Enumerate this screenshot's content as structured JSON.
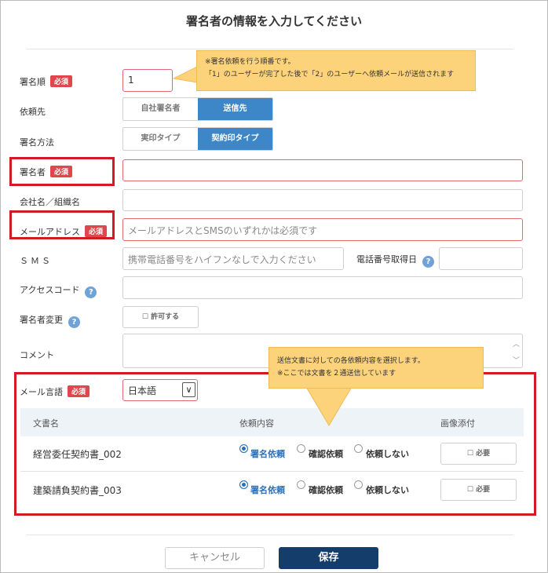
{
  "dialog": {
    "title": "署名者の情報を入力してください"
  },
  "required_badge": "必須",
  "help_glyph": "?",
  "form": {
    "order": {
      "label": "署名順",
      "value": "1"
    },
    "recipient": {
      "label": "依頼先",
      "options": [
        "自社署名者",
        "送信先"
      ],
      "selected": "送信先"
    },
    "method": {
      "label": "署名方法",
      "options": [
        "実印タイプ",
        "契約印タイプ"
      ],
      "selected": "契約印タイプ"
    },
    "signer": {
      "label": "署名者",
      "value": ""
    },
    "company": {
      "label": "会社名／組織名",
      "value": ""
    },
    "email": {
      "label": "メールアドレス",
      "placeholder": "メールアドレスとSMSのいずれかは必須です"
    },
    "sms": {
      "label": "ＳＭＳ",
      "placeholder": "携帯電話番号をハイフンなしで入力ください",
      "date_label": "電話番号取得日"
    },
    "access_code": {
      "label": "アクセスコード"
    },
    "signer_change": {
      "label": "署名者変更",
      "checkbox_label": "☐ 許可する"
    },
    "comment": {
      "label": "コメント"
    },
    "mail_language": {
      "label": "メール言語",
      "value": "日本語"
    }
  },
  "callouts": {
    "order_note_line1": "※署名依頼を行う順番です。",
    "order_note_line2": "「1」のユーザーが完了した後で「2」のユーザーへ依頼メールが送信されます",
    "docs_note_line1": "送信文書に対しての各依頼内容を選択します。",
    "docs_note_line2": "※ここでは文書を２通送信しています"
  },
  "table": {
    "headers": [
      "文書名",
      "依頼内容",
      "画像添付"
    ],
    "request_options": [
      "署名依頼",
      "確認依頼",
      "依頼しない"
    ],
    "attach_label": "☐ 必要",
    "rows": [
      {
        "doc": "経営委任契約書_002",
        "selected": "署名依頼"
      },
      {
        "doc": "建築請負契約書_003",
        "selected": "署名依頼"
      }
    ]
  },
  "buttons": {
    "cancel": "キャンセル",
    "save": "保存"
  },
  "colors": {
    "accent": "#3d86c8",
    "required": "#e0474c",
    "highlight": "#d11a24",
    "callout": "#fcd27a",
    "save": "#143d6b"
  }
}
